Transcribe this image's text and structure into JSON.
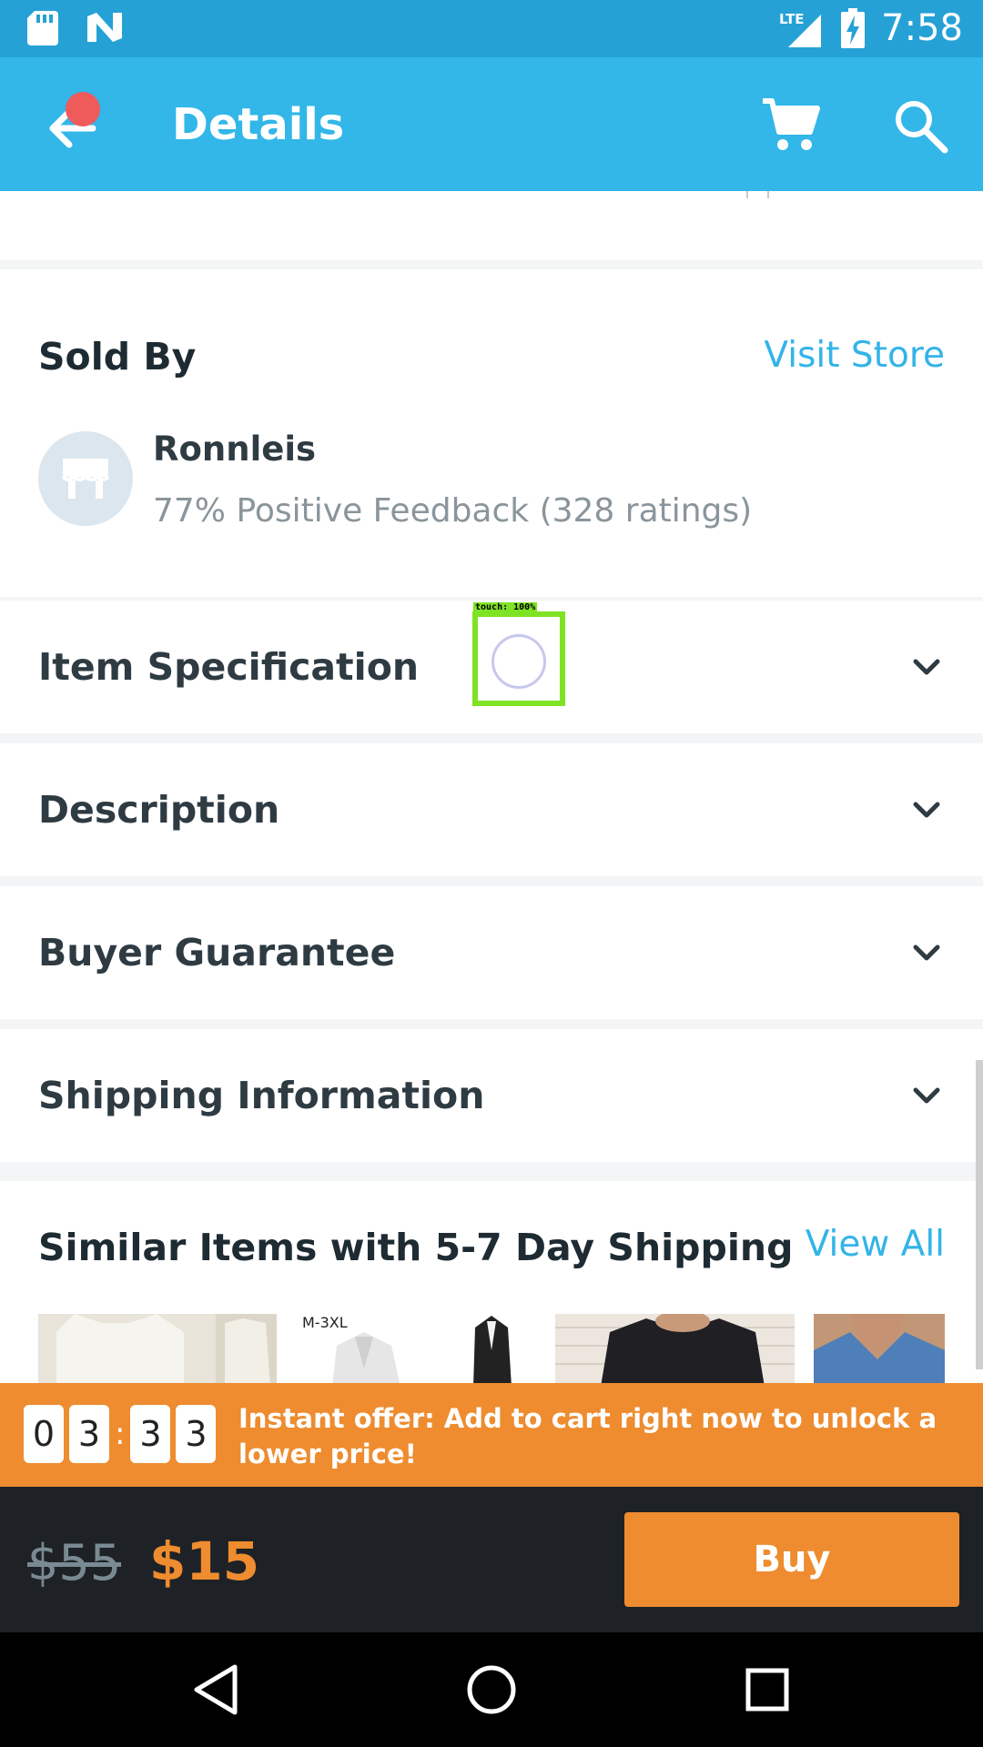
{
  "status_bar": {
    "time": "7:58",
    "network": "LTE",
    "icons": [
      "sd-card-icon",
      "n-logo-icon",
      "signal-icon",
      "battery-charging-icon"
    ]
  },
  "app_bar": {
    "title": "Details",
    "back_icon": "arrow-left-icon",
    "cart_icon": "cart-icon",
    "search_icon": "search-icon"
  },
  "sold_by": {
    "title": "Sold By",
    "visit_store": "Visit Store",
    "seller_name": "Ronnleis",
    "feedback": "77% Positive Feedback (328 ratings)"
  },
  "accordion": [
    {
      "label": "Item Specification"
    },
    {
      "label": "Description"
    },
    {
      "label": "Buyer Guarantee"
    },
    {
      "label": "Shipping Information"
    }
  ],
  "similar": {
    "title": "Similar Items with 5-7 Day Shipping",
    "view_all": "View All",
    "thumb_tag": "M-3XL"
  },
  "offer": {
    "timer": [
      "0",
      "3",
      "3",
      "3"
    ],
    "separator": ":",
    "text": "Instant offer: Add to cart right now to unlock a lower price!"
  },
  "buy_bar": {
    "old_price": "$55",
    "new_price": "$15",
    "buy_label": "Buy"
  },
  "touch_indicator": {
    "label": "touch: 100%"
  },
  "colors": {
    "status_bar": "#26a1d6",
    "app_bar": "#32b7e8",
    "accent_link": "#33b4e8",
    "offer_orange": "#ee8c2f",
    "buy_bar_bg": "#1e2227"
  }
}
